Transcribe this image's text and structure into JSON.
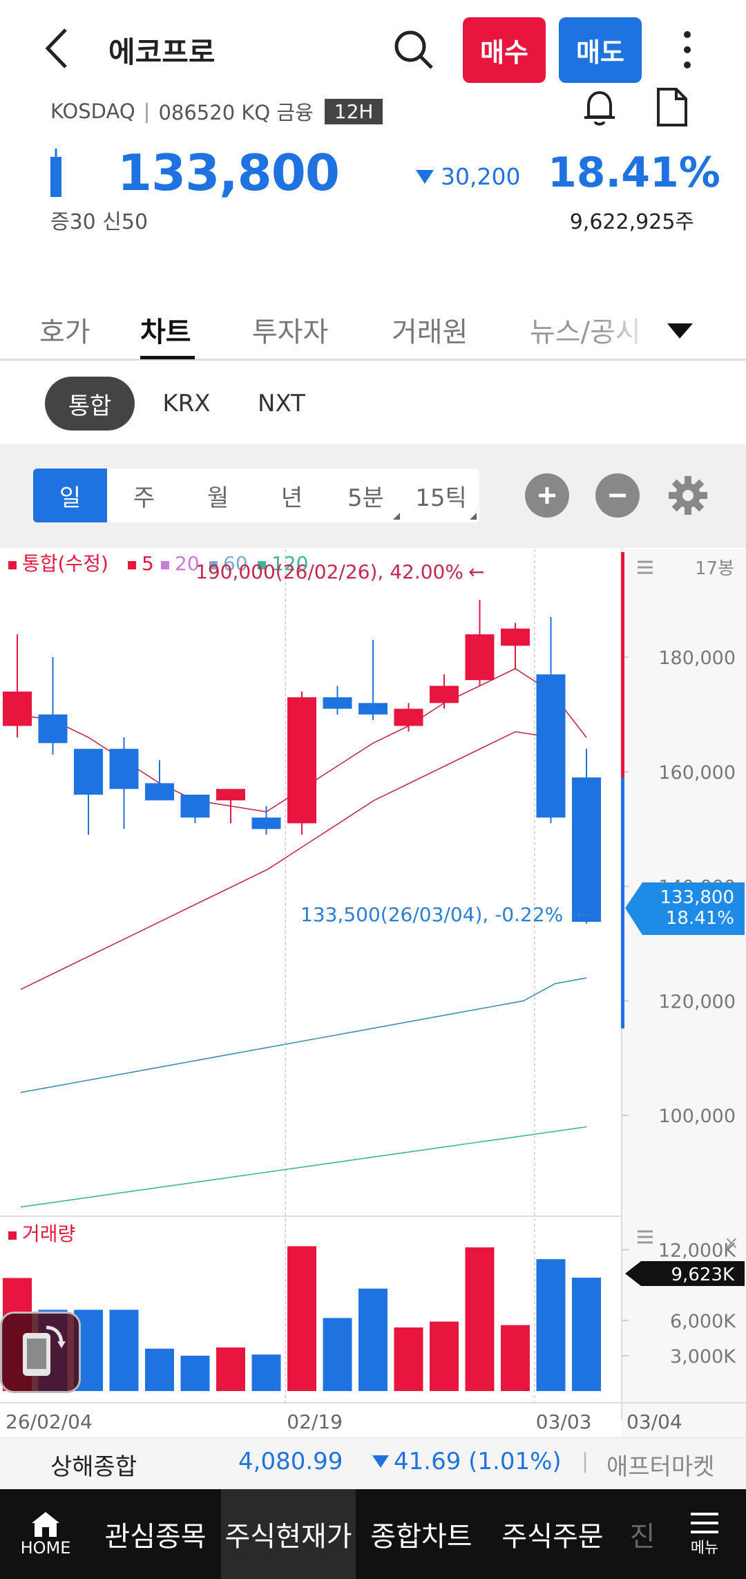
{
  "header": {
    "title": "에코프로",
    "buy_label": "매수",
    "sell_label": "매도",
    "market": "KOSDAQ",
    "code_info": "086520 KQ 금융",
    "badge": "12H",
    "colors": {
      "buy": "#e8153f",
      "sell": "#1e73e0",
      "down": "#1e73e0",
      "up": "#e8153f"
    }
  },
  "quote": {
    "price": "133,800",
    "change": "30,200",
    "change_direction": "down",
    "pct": "18.41%",
    "margins": "증30  신50",
    "volume": "9,622,925주"
  },
  "tabs": [
    {
      "label": "호가",
      "active": false
    },
    {
      "label": "차트",
      "active": true
    },
    {
      "label": "투자자",
      "active": false
    },
    {
      "label": "거래원",
      "active": false
    },
    {
      "label": "뉴스/공시",
      "active": false
    }
  ],
  "segments": [
    {
      "label": "통합",
      "active": true
    },
    {
      "label": "KRX",
      "active": false
    },
    {
      "label": "NXT",
      "active": false
    }
  ],
  "periods": [
    {
      "label": "일",
      "active": true
    },
    {
      "label": "주",
      "active": false
    },
    {
      "label": "월",
      "active": false
    },
    {
      "label": "년",
      "active": false
    },
    {
      "label": "5분",
      "active": false
    },
    {
      "label": "15틱",
      "active": false
    }
  ],
  "chart_data": {
    "type": "candlestick",
    "legend": [
      {
        "name": "통합(수정)",
        "color": "#e8153f"
      },
      {
        "name": "5",
        "color": "#e8153f"
      },
      {
        "name": "20",
        "color": "#c77dd6"
      },
      {
        "name": "60",
        "color": "#7fa8cf"
      },
      {
        "name": "120",
        "color": "#3db59a"
      }
    ],
    "bar_count_label": "17봉",
    "price_axis_ticks": [
      "180,000",
      "160,000",
      "140,000",
      "120,000",
      "100,000"
    ],
    "price_axis_values": [
      180000,
      160000,
      140000,
      120000,
      100000
    ],
    "ylim": [
      83000,
      194000
    ],
    "x_labels": [
      "26/02/04",
      "02/19",
      "03/03",
      "03/04"
    ],
    "x_label_index": [
      0,
      8,
      15,
      17
    ],
    "candles": [
      {
        "open": 168000,
        "high": 184000,
        "low": 166000,
        "close": 174000
      },
      {
        "open": 170000,
        "high": 180000,
        "low": 163000,
        "close": 165000
      },
      {
        "open": 164000,
        "high": 164000,
        "low": 149000,
        "close": 156000
      },
      {
        "open": 164000,
        "high": 166000,
        "low": 150000,
        "close": 157000
      },
      {
        "open": 158000,
        "high": 162000,
        "low": 155000,
        "close": 155000
      },
      {
        "open": 156000,
        "high": 156000,
        "low": 151000,
        "close": 152000
      },
      {
        "open": 155000,
        "high": 157000,
        "low": 151000,
        "close": 157000
      },
      {
        "open": 152000,
        "high": 154000,
        "low": 149000,
        "close": 150000
      },
      {
        "open": 151000,
        "high": 174000,
        "low": 149000,
        "close": 173000
      },
      {
        "open": 173000,
        "high": 175000,
        "low": 170000,
        "close": 171000
      },
      {
        "open": 172000,
        "high": 183000,
        "low": 169000,
        "close": 170000
      },
      {
        "open": 168000,
        "high": 172000,
        "low": 167000,
        "close": 171000
      },
      {
        "open": 172000,
        "high": 177000,
        "low": 171000,
        "close": 175000
      },
      {
        "open": 176000,
        "high": 190000,
        "low": 175000,
        "close": 184000
      },
      {
        "open": 182000,
        "high": 186000,
        "low": 178000,
        "close": 185000
      },
      {
        "open": 177000,
        "high": 187000,
        "low": 151000,
        "close": 152000
      },
      {
        "open": 159000,
        "high": 164000,
        "low": 133500,
        "close": 133800
      }
    ],
    "ma5": [
      170000,
      169000,
      166000,
      162000,
      158000,
      155000,
      154000,
      153000,
      157000,
      161000,
      165000,
      168000,
      172000,
      175000,
      178000,
      174000,
      166000
    ],
    "ma20": [
      122000,
      125000,
      128000,
      131000,
      134000,
      137000,
      140000,
      143000,
      147000,
      151000,
      155000,
      158000,
      161000,
      164000,
      167000,
      166000
    ],
    "ma60": [
      104000,
      105000,
      106000,
      107000,
      108000,
      109000,
      110000,
      111000,
      112000,
      113000,
      114000,
      115000,
      116000,
      117000,
      118000,
      119000,
      120000,
      123000,
      124000
    ],
    "ma120": [
      84000,
      85000,
      86000,
      87000,
      88000,
      89000,
      90000,
      91000,
      92000,
      93000,
      94000,
      95000,
      96000,
      97000,
      98000
    ],
    "high_annotation": "190,000(26/02/26), 42.00%",
    "low_annotation": "133,500(26/03/04), -0.22%",
    "current_price_tag": "133,800",
    "current_pct_tag": "18.41%",
    "volume": {
      "label": "거래량",
      "axis_ticks": [
        "12,000K",
        "6,000K",
        "3,000K"
      ],
      "axis_values": [
        12000,
        6000,
        3000
      ],
      "current_tag": "9,623K",
      "values_k": [
        9600,
        6900,
        6900,
        6900,
        3600,
        3000,
        3700,
        3100,
        12300,
        6200,
        8700,
        5400,
        5900,
        12200,
        5600,
        11200,
        9623
      ],
      "colors": [
        "up",
        "down",
        "down",
        "down",
        "down",
        "down",
        "up",
        "down",
        "up",
        "down",
        "down",
        "up",
        "up",
        "up",
        "up",
        "down",
        "down"
      ]
    }
  },
  "index_bar": {
    "name": "상해종합",
    "value": "4,080.99",
    "change": "41.69 (1.01%)",
    "separator": "|",
    "after_market": "애프터마켓"
  },
  "bottom_nav": {
    "home": "HOME",
    "items": [
      "관심종목",
      "주식현재가",
      "종합차트",
      "주식주문",
      "진"
    ],
    "active_index": 1,
    "menu": "메뉴"
  }
}
